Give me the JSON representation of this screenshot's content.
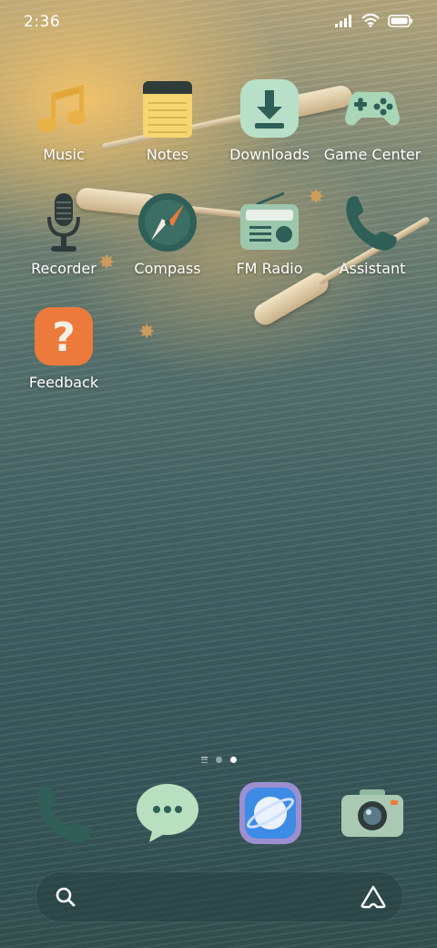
{
  "status_bar": {
    "time": "2:36",
    "icons": [
      "signal-icon",
      "wifi-icon",
      "battery-icon"
    ]
  },
  "apps": [
    {
      "label": "Music",
      "icon": "music-note-icon"
    },
    {
      "label": "Notes",
      "icon": "notepad-icon"
    },
    {
      "label": "Downloads",
      "icon": "download-icon"
    },
    {
      "label": "Game Center",
      "icon": "gamepad-icon"
    },
    {
      "label": "Recorder",
      "icon": "microphone-icon"
    },
    {
      "label": "Compass",
      "icon": "compass-icon"
    },
    {
      "label": "FM Radio",
      "icon": "radio-icon"
    },
    {
      "label": "Assistant",
      "icon": "phone-handset-icon"
    },
    {
      "label": "Feedback",
      "icon": "question-mark-icon",
      "glyph": "?"
    }
  ],
  "page_indicator": {
    "pages": 3,
    "active_page": 2
  },
  "dock": [
    {
      "name": "phone",
      "icon": "phone-icon"
    },
    {
      "name": "messages",
      "icon": "chat-bubble-icon"
    },
    {
      "name": "browser",
      "icon": "browser-planet-icon"
    },
    {
      "name": "camera",
      "icon": "camera-icon"
    }
  ],
  "search": {
    "icons": [
      "search-icon",
      "assistant-triangle-icon"
    ]
  },
  "colors": {
    "accent_green": "#2f5f57",
    "tile_mint": "#b8e0c8",
    "feedback_orange": "#ec7a3c",
    "notes_yellow": "#f4d670"
  }
}
